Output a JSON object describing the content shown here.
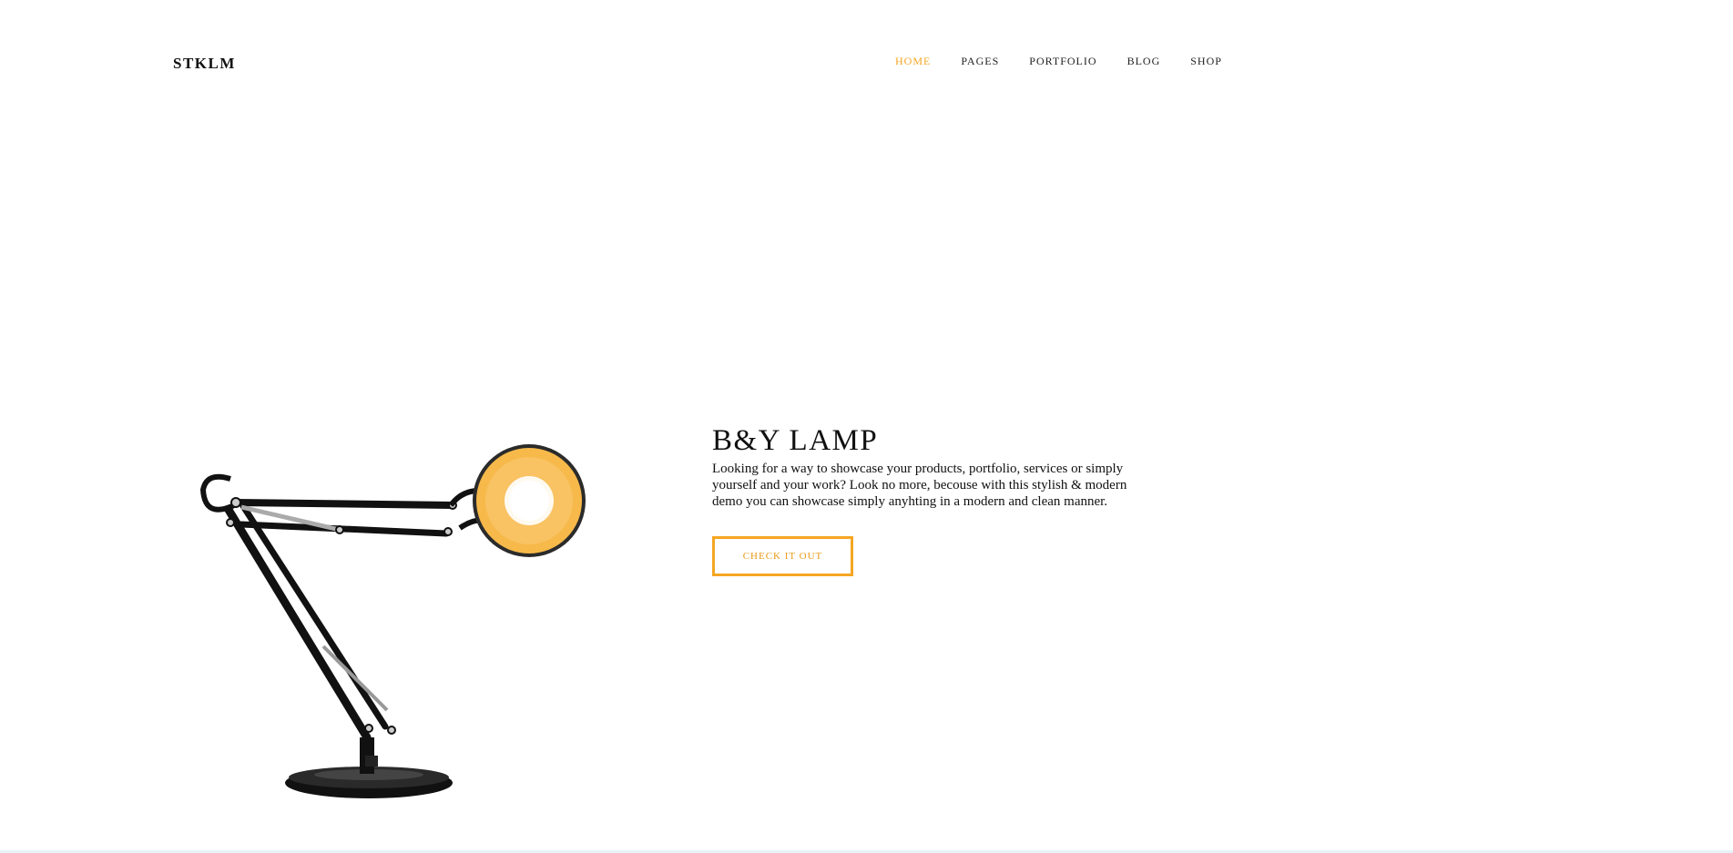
{
  "header": {
    "logo": "STKLM",
    "nav": [
      {
        "label": "HOME",
        "active": true
      },
      {
        "label": "PAGES",
        "active": false
      },
      {
        "label": "PORTFOLIO",
        "active": false
      },
      {
        "label": "BLOG",
        "active": false
      },
      {
        "label": "SHOP",
        "active": false
      }
    ]
  },
  "hero": {
    "title": "B&Y LAMP",
    "description": "Looking for a way to showcase your products, portfolio, services or simply yourself and your work? Look no more, becouse with this stylish & modern demo you can showcase simply anyhting in a modern and clean manner.",
    "cta_label": "CHECK IT OUT",
    "image": "desk-lamp-image"
  },
  "colors": {
    "accent": "#f5a623",
    "text": "#111111",
    "background": "#ffffff"
  }
}
